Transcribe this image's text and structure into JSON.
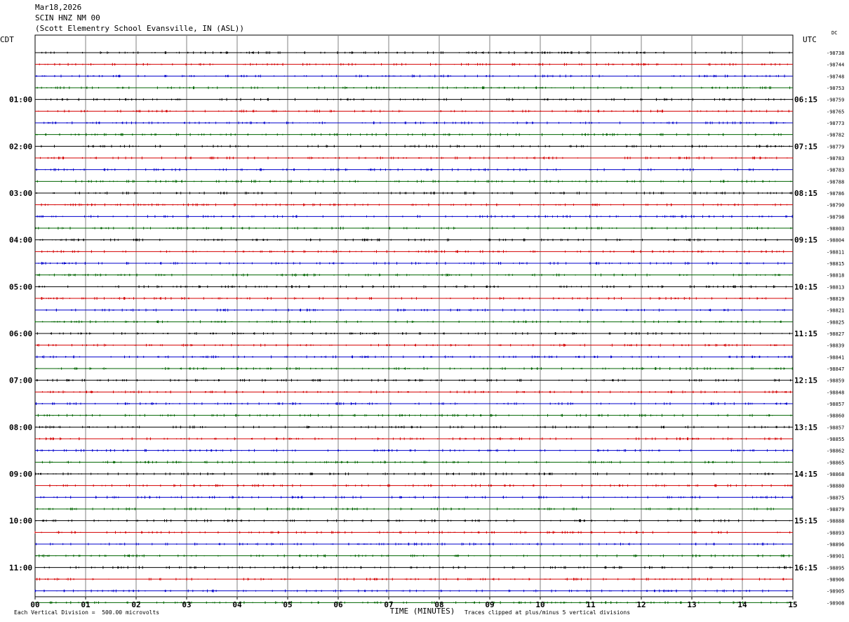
{
  "header": {
    "date": "Mar18,2026",
    "channel": "SCIN HNZ NM 00",
    "station": "(Scott Elementry School Evansville, IN (ASL))"
  },
  "footer": {
    "vertical_division": "Each Vertical Division =  500.00 microvolts",
    "clip_note": "Traces clipped at plus/minus 5 vertical divisions"
  },
  "colors": {
    "background": "#ffffff",
    "grid_line": "#000000",
    "minute_line": "#808080",
    "trace_cycle": [
      "#000000",
      "#d40000",
      "#0000cc",
      "#006400"
    ]
  },
  "chart_data": {
    "type": "line",
    "title": "",
    "xlabel": "TIME (MINUTES)",
    "ylabel_left": "CDT",
    "ylabel_right": "UTC",
    "dc_label": "DC",
    "xlim": [
      0,
      15
    ],
    "x_ticks": [
      "00",
      "01",
      "02",
      "03",
      "04",
      "05",
      "06",
      "07",
      "08",
      "09",
      "10",
      "11",
      "12",
      "13",
      "14",
      "15"
    ],
    "rows_per_hour": 4,
    "minutes_per_row": 15,
    "cdt_ticks": [
      "01:00",
      "02:00",
      "03:00",
      "04:00",
      "05:00",
      "06:00",
      "07:00",
      "08:00",
      "09:00",
      "10:00",
      "11:00"
    ],
    "utc_ticks": [
      "06:15",
      "07:15",
      "08:15",
      "09:15",
      "10:15",
      "11:15",
      "12:15",
      "13:15",
      "14:15",
      "15:15",
      "16:15"
    ],
    "dc_offsets": [
      "-98738",
      "-98744",
      "-98748",
      "-98753",
      "-98759",
      "-98765",
      "-98773",
      "-98782",
      "-98779",
      "-98783",
      "-98783",
      "-98788",
      "-98786",
      "-98790",
      "-98798",
      "-98803",
      "-98804",
      "-98811",
      "-98815",
      "-98818",
      "-98813",
      "-98819",
      "-98821",
      "-98825",
      "-98827",
      "-98839",
      "-98841",
      "-98847",
      "-98859",
      "-98848",
      "-98857",
      "-98860",
      "-98857",
      "-98855",
      "-98862",
      "-98865",
      "-98868",
      "-98880",
      "-98875",
      "-98879",
      "-98888",
      "-98893",
      "-98896",
      "-98901",
      "-98895",
      "-98906",
      "-98905",
      "-98908"
    ],
    "grid": true
  }
}
